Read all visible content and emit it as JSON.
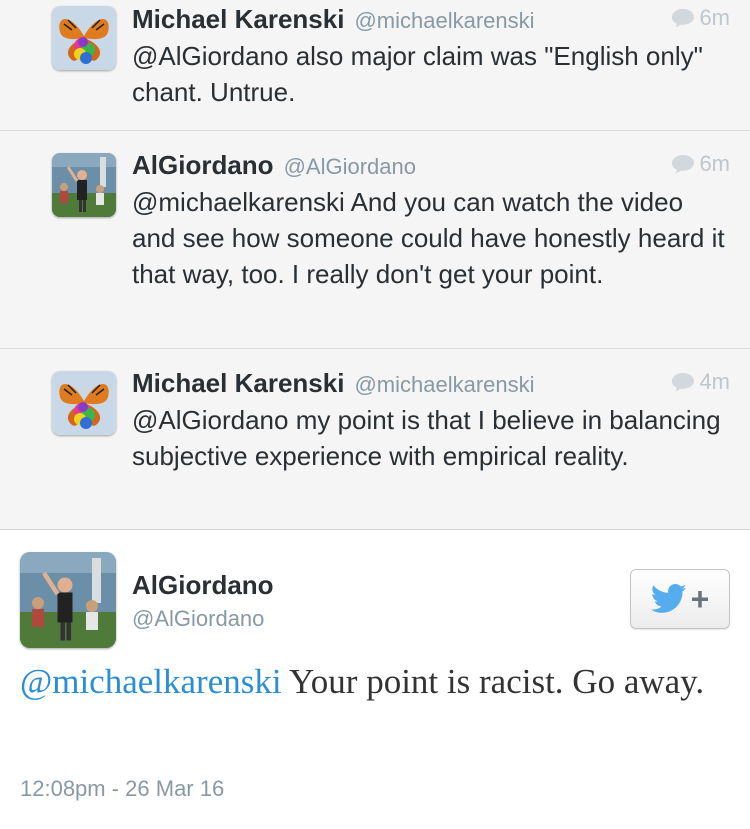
{
  "replies": [
    {
      "name": "Michael Karenski",
      "handle": "@michaelkarenski",
      "time": "6m",
      "text": "@AlGiordano also major claim was \"English only\" chant. Untrue."
    },
    {
      "name": "AlGiordano",
      "handle": "@AlGiordano",
      "time": "6m",
      "text": "@michaelkarenski And you can watch the video and see how someone could have honestly heard it that way, too. I really don't get your point."
    },
    {
      "name": "Michael Karenski",
      "handle": "@michaelkarenski",
      "time": "4m",
      "text": "@AlGiordano my point is that I believe in balancing subjective experience with empirical reality."
    }
  ],
  "main_tweet": {
    "name": "AlGiordano",
    "handle": "@AlGiordano",
    "mention": "@michaelkarenski",
    "text_rest": " Your point is racist. Go away.",
    "timestamp": "12:08pm - 26 Mar 16",
    "follow_plus": "+"
  },
  "colors": {
    "brand": "#55acee",
    "mention": "#2a8ed6"
  },
  "icons": {
    "reply_indicator": "speech-bubble-icon",
    "follow": "twitter-bird-icon"
  }
}
